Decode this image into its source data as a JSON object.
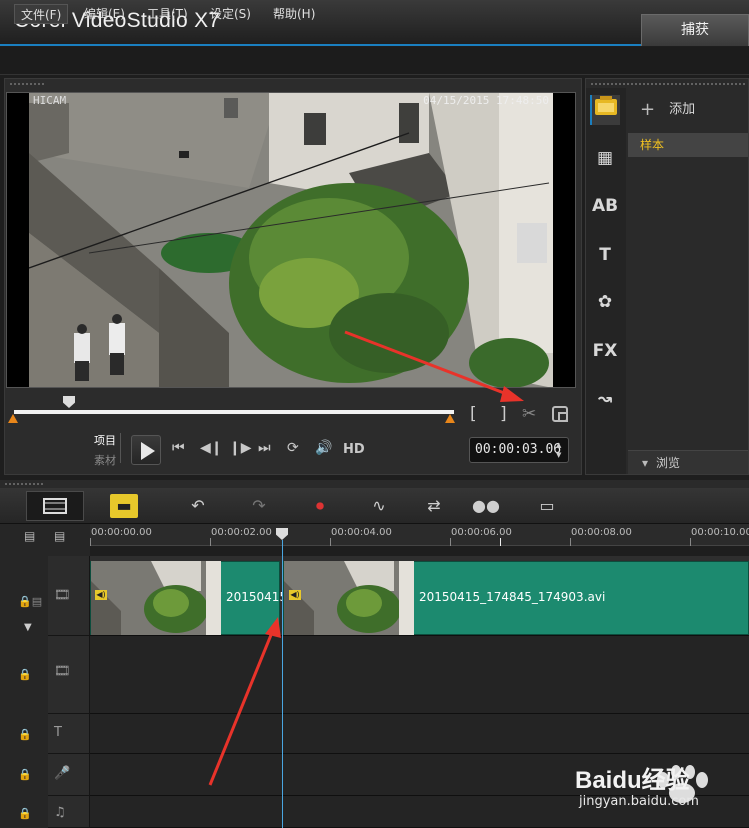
{
  "app": {
    "title": "Corel  VideoStudio X7",
    "capture_tab": "捕获"
  },
  "menu": [
    {
      "label": "文件(F)",
      "active": true
    },
    {
      "label": "编辑(E)",
      "active": false
    },
    {
      "label": "工具(T)",
      "active": false
    },
    {
      "label": "设定(S)",
      "active": false
    },
    {
      "label": "帮助(H)",
      "active": false
    }
  ],
  "preview": {
    "osd_left": "HICAM",
    "osd_right": "04/15/2015  17:48:50"
  },
  "player": {
    "mark_in": "[",
    "mark_out": "]",
    "mode_project": "项目",
    "mode_clip": "素材",
    "hd_label": "HD",
    "timecode": "00:00:03.06"
  },
  "library": {
    "add_label": "添加",
    "folder_sample": "样本",
    "browse_label": "浏览"
  },
  "timeline": {
    "ruler_labels": [
      "00:00:00.00",
      "00:00:02.00",
      "00:00:04.00",
      "00:00:06.00",
      "00:00:08.00",
      "00:00:10.00"
    ],
    "clips": [
      {
        "label": "20150415"
      },
      {
        "label": "20150415_174845_174903.avi"
      }
    ]
  },
  "watermark": {
    "brand": "Baidu经验",
    "url": "jingyan.baidu.com"
  },
  "colors": {
    "accent_blue": "#1a7fc0",
    "clip_green": "#1c8a6f",
    "annotation_red": "#e8332a",
    "highlight_yellow": "#e7c82b"
  }
}
